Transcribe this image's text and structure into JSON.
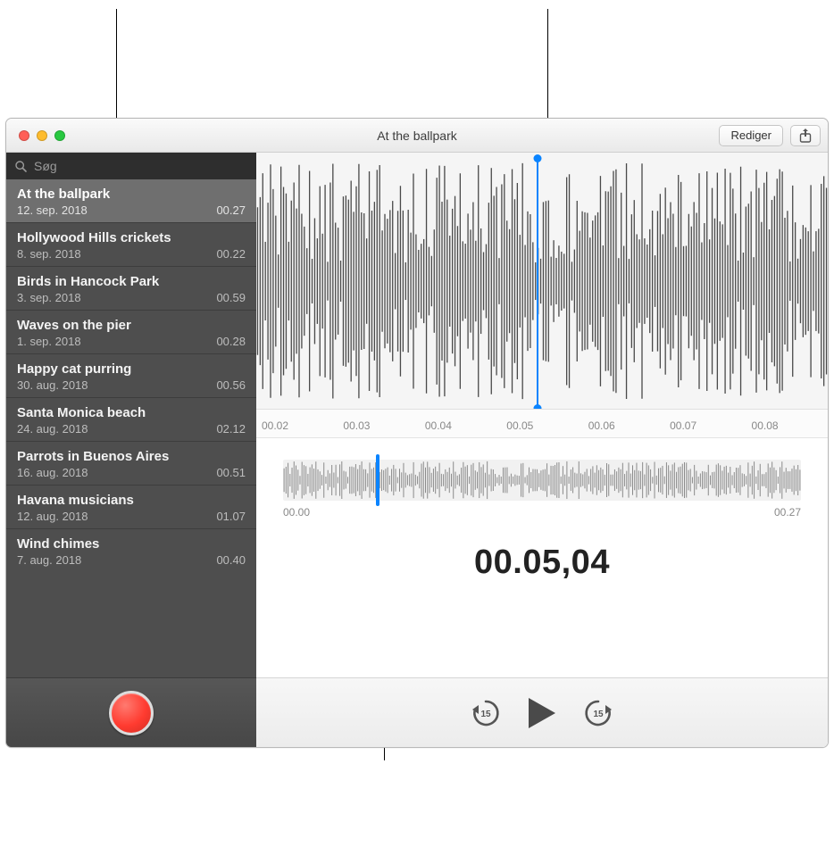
{
  "window": {
    "title": "At the ballpark",
    "edit_button": "Rediger"
  },
  "search": {
    "placeholder": "Søg"
  },
  "recordings": [
    {
      "title": "At the ballpark",
      "date": "12. sep. 2018",
      "duration": "00.27",
      "selected": true
    },
    {
      "title": "Hollywood Hills crickets",
      "date": "8. sep. 2018",
      "duration": "00.22",
      "selected": false
    },
    {
      "title": "Birds in Hancock Park",
      "date": "3. sep. 2018",
      "duration": "00.59",
      "selected": false
    },
    {
      "title": "Waves on the pier",
      "date": "1. sep. 2018",
      "duration": "00.28",
      "selected": false
    },
    {
      "title": "Happy cat purring",
      "date": "30. aug. 2018",
      "duration": "00.56",
      "selected": false
    },
    {
      "title": "Santa Monica beach",
      "date": "24. aug. 2018",
      "duration": "02.12",
      "selected": false
    },
    {
      "title": "Parrots in Buenos Aires",
      "date": "16. aug. 2018",
      "duration": "00.51",
      "selected": false
    },
    {
      "title": "Havana musicians",
      "date": "12. aug. 2018",
      "duration": "01.07",
      "selected": false
    },
    {
      "title": "Wind chimes",
      "date": "7. aug. 2018",
      "duration": "00.40",
      "selected": false
    }
  ],
  "detail": {
    "ruler_ticks": [
      "00.02",
      "00.03",
      "00.04",
      "00.05",
      "00.06",
      "00.07",
      "00.08"
    ],
    "playhead_position_pct": 49,
    "overview_playhead_pct": 18,
    "overview_start": "00.00",
    "overview_end": "00.27",
    "time_display": "00.05,04",
    "skip_back_seconds": "15",
    "skip_forward_seconds": "15"
  }
}
